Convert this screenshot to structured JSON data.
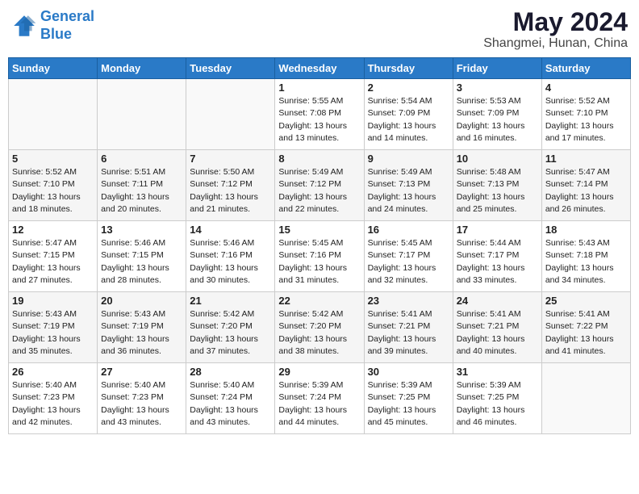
{
  "logo": {
    "line1": "General",
    "line2": "Blue"
  },
  "title": "May 2024",
  "location": "Shangmei, Hunan, China",
  "weekdays": [
    "Sunday",
    "Monday",
    "Tuesday",
    "Wednesday",
    "Thursday",
    "Friday",
    "Saturday"
  ],
  "weeks": [
    [
      {
        "day": "",
        "sunrise": "",
        "sunset": "",
        "daylight": ""
      },
      {
        "day": "",
        "sunrise": "",
        "sunset": "",
        "daylight": ""
      },
      {
        "day": "",
        "sunrise": "",
        "sunset": "",
        "daylight": ""
      },
      {
        "day": "1",
        "sunrise": "Sunrise: 5:55 AM",
        "sunset": "Sunset: 7:08 PM",
        "daylight": "Daylight: 13 hours and 13 minutes."
      },
      {
        "day": "2",
        "sunrise": "Sunrise: 5:54 AM",
        "sunset": "Sunset: 7:09 PM",
        "daylight": "Daylight: 13 hours and 14 minutes."
      },
      {
        "day": "3",
        "sunrise": "Sunrise: 5:53 AM",
        "sunset": "Sunset: 7:09 PM",
        "daylight": "Daylight: 13 hours and 16 minutes."
      },
      {
        "day": "4",
        "sunrise": "Sunrise: 5:52 AM",
        "sunset": "Sunset: 7:10 PM",
        "daylight": "Daylight: 13 hours and 17 minutes."
      }
    ],
    [
      {
        "day": "5",
        "sunrise": "Sunrise: 5:52 AM",
        "sunset": "Sunset: 7:10 PM",
        "daylight": "Daylight: 13 hours and 18 minutes."
      },
      {
        "day": "6",
        "sunrise": "Sunrise: 5:51 AM",
        "sunset": "Sunset: 7:11 PM",
        "daylight": "Daylight: 13 hours and 20 minutes."
      },
      {
        "day": "7",
        "sunrise": "Sunrise: 5:50 AM",
        "sunset": "Sunset: 7:12 PM",
        "daylight": "Daylight: 13 hours and 21 minutes."
      },
      {
        "day": "8",
        "sunrise": "Sunrise: 5:49 AM",
        "sunset": "Sunset: 7:12 PM",
        "daylight": "Daylight: 13 hours and 22 minutes."
      },
      {
        "day": "9",
        "sunrise": "Sunrise: 5:49 AM",
        "sunset": "Sunset: 7:13 PM",
        "daylight": "Daylight: 13 hours and 24 minutes."
      },
      {
        "day": "10",
        "sunrise": "Sunrise: 5:48 AM",
        "sunset": "Sunset: 7:13 PM",
        "daylight": "Daylight: 13 hours and 25 minutes."
      },
      {
        "day": "11",
        "sunrise": "Sunrise: 5:47 AM",
        "sunset": "Sunset: 7:14 PM",
        "daylight": "Daylight: 13 hours and 26 minutes."
      }
    ],
    [
      {
        "day": "12",
        "sunrise": "Sunrise: 5:47 AM",
        "sunset": "Sunset: 7:15 PM",
        "daylight": "Daylight: 13 hours and 27 minutes."
      },
      {
        "day": "13",
        "sunrise": "Sunrise: 5:46 AM",
        "sunset": "Sunset: 7:15 PM",
        "daylight": "Daylight: 13 hours and 28 minutes."
      },
      {
        "day": "14",
        "sunrise": "Sunrise: 5:46 AM",
        "sunset": "Sunset: 7:16 PM",
        "daylight": "Daylight: 13 hours and 30 minutes."
      },
      {
        "day": "15",
        "sunrise": "Sunrise: 5:45 AM",
        "sunset": "Sunset: 7:16 PM",
        "daylight": "Daylight: 13 hours and 31 minutes."
      },
      {
        "day": "16",
        "sunrise": "Sunrise: 5:45 AM",
        "sunset": "Sunset: 7:17 PM",
        "daylight": "Daylight: 13 hours and 32 minutes."
      },
      {
        "day": "17",
        "sunrise": "Sunrise: 5:44 AM",
        "sunset": "Sunset: 7:17 PM",
        "daylight": "Daylight: 13 hours and 33 minutes."
      },
      {
        "day": "18",
        "sunrise": "Sunrise: 5:43 AM",
        "sunset": "Sunset: 7:18 PM",
        "daylight": "Daylight: 13 hours and 34 minutes."
      }
    ],
    [
      {
        "day": "19",
        "sunrise": "Sunrise: 5:43 AM",
        "sunset": "Sunset: 7:19 PM",
        "daylight": "Daylight: 13 hours and 35 minutes."
      },
      {
        "day": "20",
        "sunrise": "Sunrise: 5:43 AM",
        "sunset": "Sunset: 7:19 PM",
        "daylight": "Daylight: 13 hours and 36 minutes."
      },
      {
        "day": "21",
        "sunrise": "Sunrise: 5:42 AM",
        "sunset": "Sunset: 7:20 PM",
        "daylight": "Daylight: 13 hours and 37 minutes."
      },
      {
        "day": "22",
        "sunrise": "Sunrise: 5:42 AM",
        "sunset": "Sunset: 7:20 PM",
        "daylight": "Daylight: 13 hours and 38 minutes."
      },
      {
        "day": "23",
        "sunrise": "Sunrise: 5:41 AM",
        "sunset": "Sunset: 7:21 PM",
        "daylight": "Daylight: 13 hours and 39 minutes."
      },
      {
        "day": "24",
        "sunrise": "Sunrise: 5:41 AM",
        "sunset": "Sunset: 7:21 PM",
        "daylight": "Daylight: 13 hours and 40 minutes."
      },
      {
        "day": "25",
        "sunrise": "Sunrise: 5:41 AM",
        "sunset": "Sunset: 7:22 PM",
        "daylight": "Daylight: 13 hours and 41 minutes."
      }
    ],
    [
      {
        "day": "26",
        "sunrise": "Sunrise: 5:40 AM",
        "sunset": "Sunset: 7:23 PM",
        "daylight": "Daylight: 13 hours and 42 minutes."
      },
      {
        "day": "27",
        "sunrise": "Sunrise: 5:40 AM",
        "sunset": "Sunset: 7:23 PM",
        "daylight": "Daylight: 13 hours and 43 minutes."
      },
      {
        "day": "28",
        "sunrise": "Sunrise: 5:40 AM",
        "sunset": "Sunset: 7:24 PM",
        "daylight": "Daylight: 13 hours and 43 minutes."
      },
      {
        "day": "29",
        "sunrise": "Sunrise: 5:39 AM",
        "sunset": "Sunset: 7:24 PM",
        "daylight": "Daylight: 13 hours and 44 minutes."
      },
      {
        "day": "30",
        "sunrise": "Sunrise: 5:39 AM",
        "sunset": "Sunset: 7:25 PM",
        "daylight": "Daylight: 13 hours and 45 minutes."
      },
      {
        "day": "31",
        "sunrise": "Sunrise: 5:39 AM",
        "sunset": "Sunset: 7:25 PM",
        "daylight": "Daylight: 13 hours and 46 minutes."
      },
      {
        "day": "",
        "sunrise": "",
        "sunset": "",
        "daylight": ""
      }
    ]
  ]
}
